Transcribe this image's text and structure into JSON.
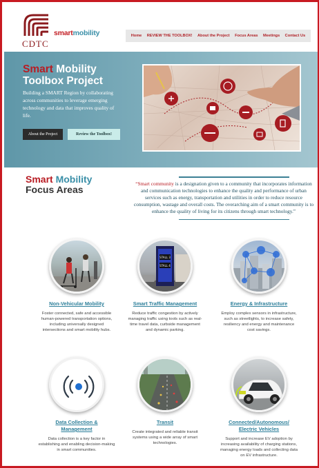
{
  "logo": {
    "word1": "smart",
    "word2": "mobility",
    "org": "CDTC"
  },
  "nav": [
    "Home",
    "REVIEW THE TOOLBOX!",
    "About the Project",
    "Focus Areas",
    "Meetings",
    "Contact Us"
  ],
  "hero": {
    "title_red": "Smart",
    "title_rest": "Mobility",
    "title_line2": "Toolbox Project",
    "description": "Building a SMART Region by collaborating across communities to leverage emerging technology and data that improves quality of life.",
    "btn_about": "About the Project",
    "btn_review": "Review the Toolbox!"
  },
  "focus": {
    "title_red": "Smart",
    "title_blue": "Mobility",
    "title_line2": "Focus Areas",
    "quote_highlight": "“Smart community",
    "quote_rest": " is a designation given to a community that incorporates information and communication technologies to enhance the quality and performance of urban services such as energy, transportation and utilities in order to reduce resource consumption, wastage and overall costs. The overarching aim of a smart community is to enhance the quality of living for its citizens through smart technology.”"
  },
  "cards": [
    {
      "title": "Non-Vehicular Mobility",
      "desc": "Foster connected, safe and accessible human-powered transportation options, including universally designed intersections and smart mobility hubs."
    },
    {
      "title": "Smart Traffic Management",
      "desc": "Reduce traffic congestion by actively managing traffic using tools such as real-time travel data, curbside management and dynamic parking.",
      "stall1": "STALL 3",
      "stall2": "STALL 4"
    },
    {
      "title": "Energy & Infrastructure",
      "desc": "Employ complex sensors in infrastructure, such as streetlights, to increase safety, resiliency and energy and maintenance cost savings."
    },
    {
      "title": "Data Collection & Management",
      "desc": "Data collection is a key factor in establishing and enabling decision-making in smart communities."
    },
    {
      "title": "Transit",
      "desc": "Create integrated and reliable transit systems using a wide array of smart technologies."
    },
    {
      "title": "Connected/Autonomous/ Electric Vehicles",
      "desc": "Support and increase EV adoption by increasing availability of charging stations, managing energy loads and collecting data on EV infrastructure."
    }
  ],
  "colors": {
    "brand_red": "#b81c23",
    "brand_blue": "#3a8fa8",
    "hero_bg": "#6fa3b3",
    "link": "#2d7f9a"
  }
}
